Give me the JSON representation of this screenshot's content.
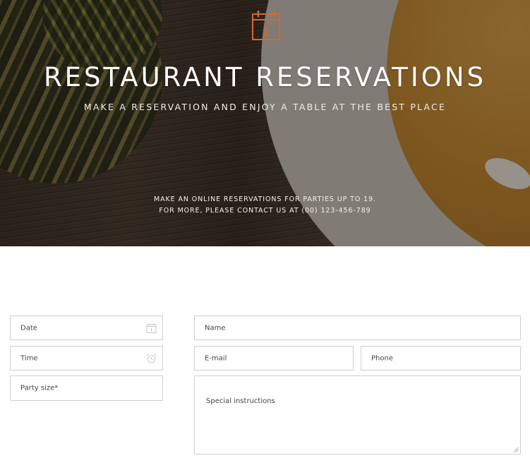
{
  "hero": {
    "title": "RESTAURANT RESERVATIONS",
    "subtitle": "MAKE A RESERVATION AND ENJOY A TABLE AT THE BEST PLACE",
    "note_line1": "MAKE AN ONLINE RESERVATIONS FOR PARTIES UP TO 19.",
    "note_line2": "FOR MORE, PLEASE CONTACT US AT (00) 123-456-789",
    "calendar_icon_number": "1",
    "icon": "calendar-icon",
    "accent_color": "#d36b2a"
  },
  "form": {
    "date_placeholder": "Date",
    "date_icon": "calendar-icon",
    "time_placeholder": "Time",
    "time_icon": "alarm-clock-icon",
    "party_size_placeholder": "Party size*",
    "name_placeholder": "Name",
    "email_placeholder": "E-mail",
    "phone_placeholder": "Phone",
    "instructions_placeholder": "Special instructions"
  }
}
